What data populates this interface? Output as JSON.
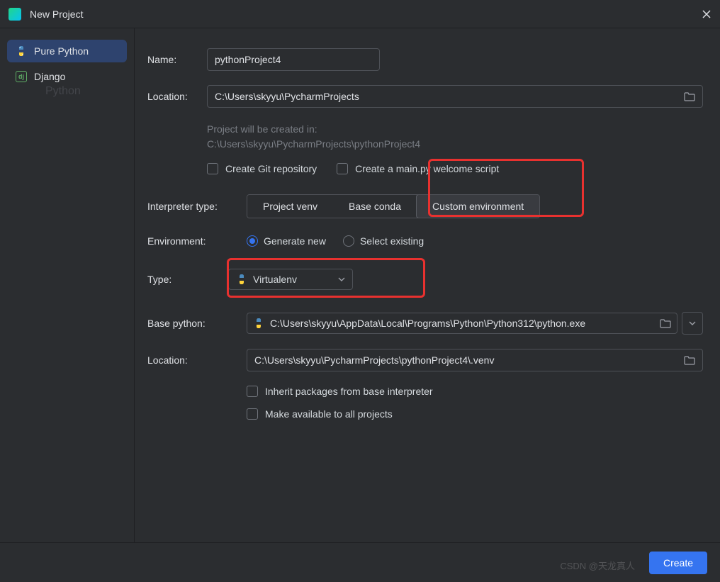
{
  "titlebar": {
    "title": "New Project"
  },
  "sidebar": {
    "items": [
      {
        "label": "Pure Python",
        "active": true
      },
      {
        "label": "Django",
        "active": false
      }
    ],
    "watermark": "Python"
  },
  "form": {
    "name_label": "Name:",
    "name_value": "pythonProject4",
    "location_label": "Location:",
    "location_value": "C:\\Users\\skyyu\\PycharmProjects",
    "hint_line1": "Project will be created in:",
    "hint_line2": "C:\\Users\\skyyu\\PycharmProjects\\pythonProject4",
    "checkbox_git": "Create Git repository",
    "checkbox_main": "Create a main.py welcome script",
    "interpreter_label": "Interpreter type:",
    "interpreter_options": [
      "Project venv",
      "Base conda",
      "Custom environment"
    ],
    "interpreter_selected": 2,
    "env_label": "Environment:",
    "env_options": [
      "Generate new",
      "Select existing"
    ],
    "env_selected": 0,
    "type_label": "Type:",
    "type_value": "Virtualenv",
    "base_python_label": "Base python:",
    "base_python_value": "C:\\Users\\skyyu\\AppData\\Local\\Programs\\Python\\Python312\\python.exe",
    "venv_location_label": "Location:",
    "venv_location_value": "C:\\Users\\skyyu\\PycharmProjects\\pythonProject4\\.venv",
    "checkbox_inherit": "Inherit packages from base interpreter",
    "checkbox_available": "Make available to all projects"
  },
  "footer": {
    "create": "Create"
  },
  "watermark_csdn": "CSDN @天龙真人"
}
